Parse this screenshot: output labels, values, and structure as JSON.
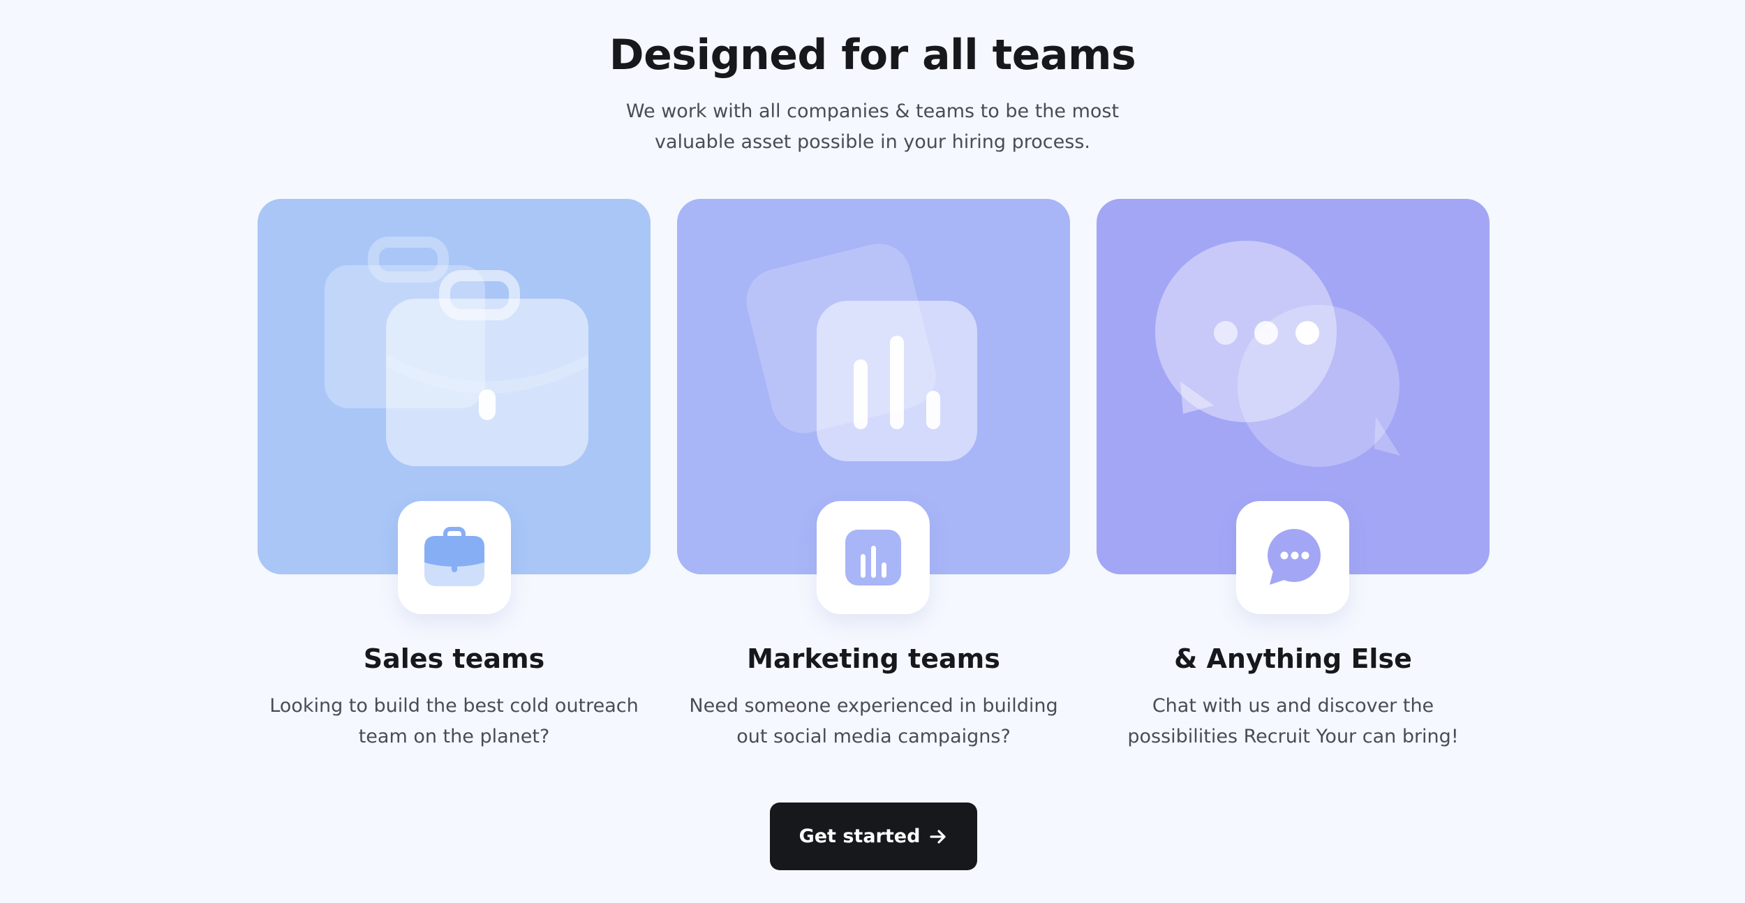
{
  "section": {
    "title": "Designed for all teams",
    "subtitle": "We work with all companies & teams to be the most valuable asset possible in your hiring process."
  },
  "cards": [
    {
      "title": "Sales teams",
      "description": "Looking to build the best cold outreach team on the planet?",
      "icon": "briefcase-icon",
      "color": "#a9c6f7"
    },
    {
      "title": "Marketing teams",
      "description": "Need someone experienced in building out social media campaigns?",
      "icon": "bar-chart-icon",
      "color": "#a8b5f7"
    },
    {
      "title": "& Anything Else",
      "description": "Chat with us and discover the possibilities Recruit Your can bring!",
      "icon": "chat-bubble-icon",
      "color": "#a3a6f5"
    }
  ],
  "cta": {
    "label": "Get started",
    "icon": "arrow-right-icon",
    "color": "#17181c"
  }
}
